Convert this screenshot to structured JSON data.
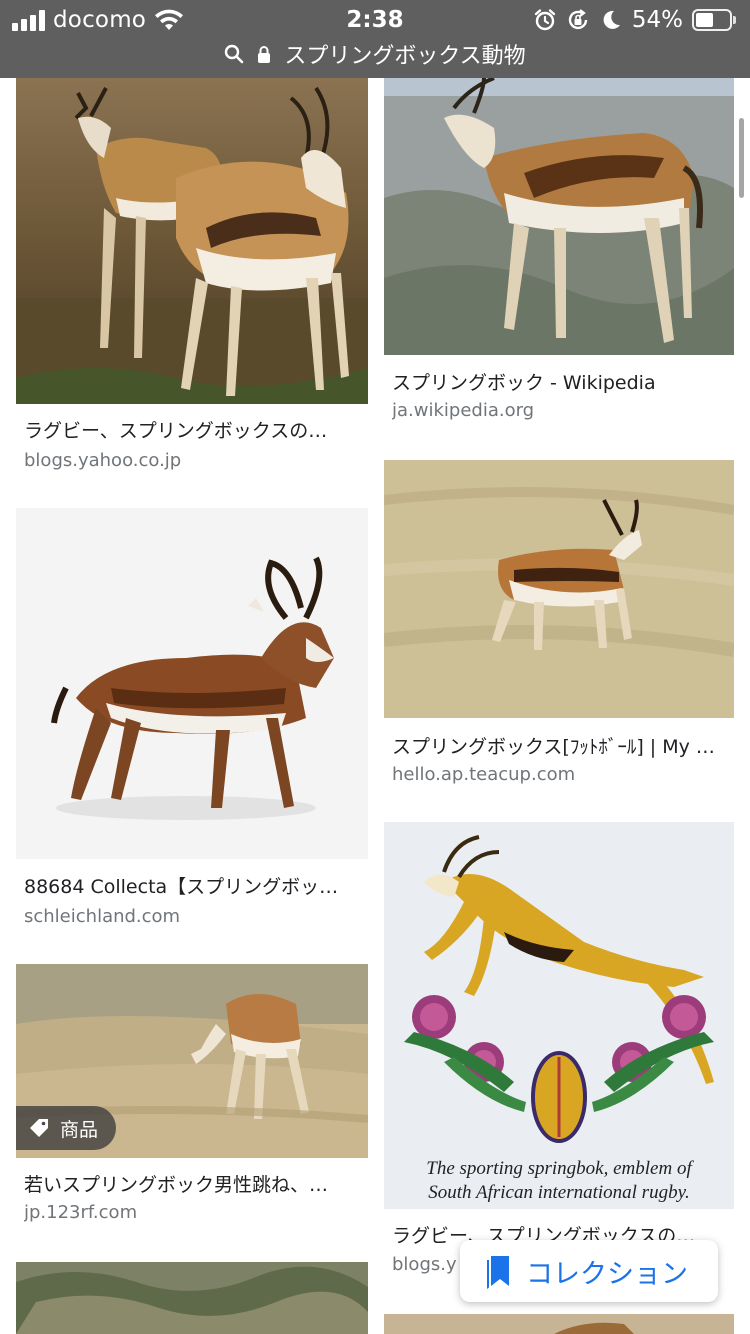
{
  "status_bar": {
    "carrier": "docomo",
    "time": "2:38",
    "battery_percent": "54%",
    "battery_level": 0.54
  },
  "address_bar": {
    "query": "スプリングボックス動物"
  },
  "results": [
    {
      "title": "ラグビー、スプリングボックスの…",
      "source": "blogs.yahoo.co.jp"
    },
    {
      "title": "スプリングボック - Wikipedia",
      "source": "ja.wikipedia.org"
    },
    {
      "title": "88684 Collecta【スプリングボッ…",
      "source": "schleichland.com"
    },
    {
      "title": "スプリングボックス[ﾌｯﾄﾎﾞｰﾙ] | My …",
      "source": "hello.ap.teacup.com"
    },
    {
      "title": "若いスプリングボック男性跳ね、…",
      "source": "jp.123rf.com",
      "badge": "商品"
    },
    {
      "title": "ラグビー、スプリングボックスの…",
      "source": "blogs.y",
      "image_caption": "The sporting springbok, emblem of South African international rugby."
    }
  ],
  "collection_button": {
    "label": "コレクション"
  },
  "colors": {
    "accent": "#1a73e8",
    "status_bar": "#5f5f5f"
  }
}
